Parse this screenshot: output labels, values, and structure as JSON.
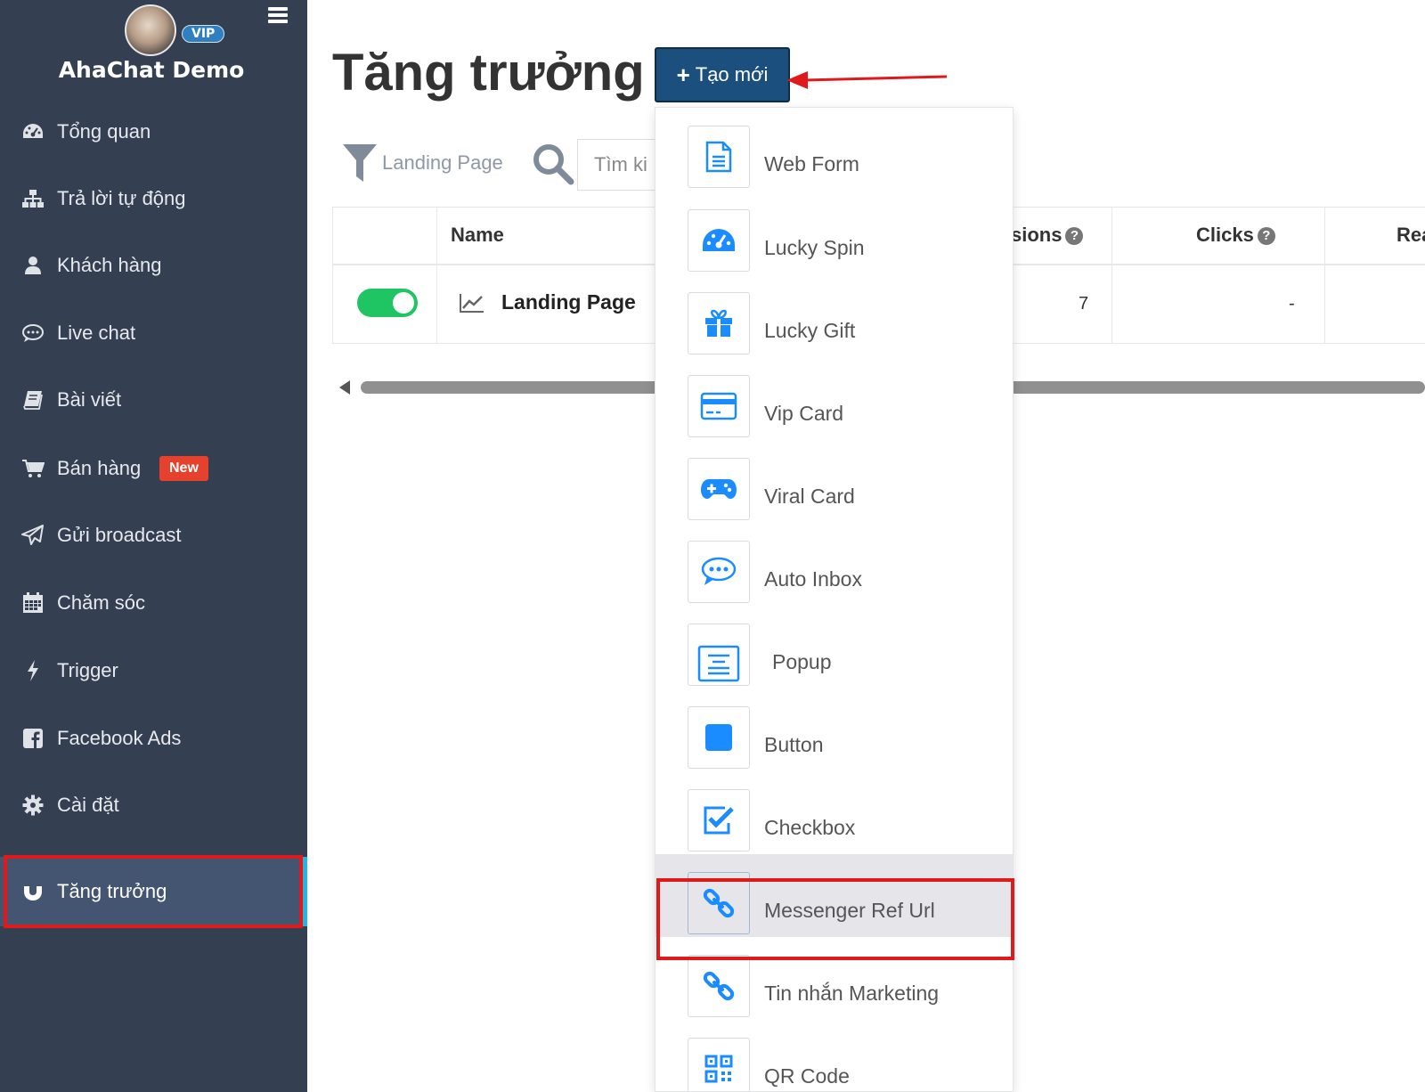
{
  "sidebar": {
    "app_name": "AhaChat Demo",
    "vip_label": "VIP",
    "items": [
      {
        "label": "Tổng quan",
        "icon": "dashboard-icon"
      },
      {
        "label": "Trả lời tự động",
        "icon": "sitemap-icon"
      },
      {
        "label": "Khách hàng",
        "icon": "user-icon"
      },
      {
        "label": "Live chat",
        "icon": "chat-icon"
      },
      {
        "label": "Bài viết",
        "icon": "book-icon"
      },
      {
        "label": "Bán hàng",
        "icon": "cart-icon",
        "badge": "New"
      },
      {
        "label": "Gửi broadcast",
        "icon": "send-icon"
      },
      {
        "label": "Chăm sóc",
        "icon": "calendar-icon"
      },
      {
        "label": "Trigger",
        "icon": "bolt-icon"
      },
      {
        "label": "Facebook Ads",
        "icon": "facebook-icon"
      },
      {
        "label": "Cài đặt",
        "icon": "gear-icon"
      },
      {
        "label": "Tăng trưởng",
        "icon": "magnet-icon",
        "active": true
      }
    ]
  },
  "main": {
    "title": "Tăng trưởng",
    "create_button": "Tạo mới",
    "filter_label": "Landing Page",
    "search_placeholder": "Tìm ki",
    "table": {
      "headers": {
        "name": "Name",
        "sessions": "sions",
        "clicks": "Clicks",
        "rea": "Rea"
      },
      "row": {
        "name": "Landing Page",
        "sessions": "7",
        "clicks": "-"
      }
    }
  },
  "dropdown": {
    "items": [
      {
        "label": "Web Form",
        "icon": "document-icon"
      },
      {
        "label": "Lucky Spin",
        "icon": "dashboard-icon"
      },
      {
        "label": "Lucky Gift",
        "icon": "gift-icon"
      },
      {
        "label": "Vip Card",
        "icon": "credit-card-icon"
      },
      {
        "label": "Viral Card",
        "icon": "gamepad-icon"
      },
      {
        "label": "Auto Inbox",
        "icon": "chat-bubble-icon"
      },
      {
        "label": "Popup",
        "icon": "popup-icon"
      },
      {
        "label": "Button",
        "icon": "square-icon"
      },
      {
        "label": "Checkbox",
        "icon": "checkbox-icon"
      },
      {
        "label": "Messenger Ref Url",
        "icon": "link-icon",
        "highlighted": true
      },
      {
        "label": "Tin nhắn Marketing",
        "icon": "link-icon"
      },
      {
        "label": "QR Code",
        "icon": "qrcode-icon"
      }
    ]
  },
  "colors": {
    "sidebar_bg": "#343f51",
    "active_bg": "#445571",
    "primary_button": "#1b4f7d",
    "icon_blue": "#1a8cff",
    "toggle_on": "#1fc563",
    "annotation_red": "#e01a1a",
    "badge_new": "#e5412d"
  }
}
